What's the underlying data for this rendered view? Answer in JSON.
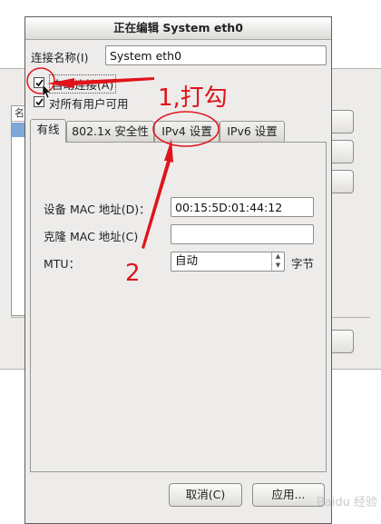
{
  "dialog": {
    "title": "正在编辑 System eth0",
    "connection_name_label": "连接名称(I)",
    "connection_name_value": "System eth0",
    "auto_connect_label": "自动连接(A)",
    "auto_connect_checked": true,
    "all_users_label": "对所有用户可用",
    "all_users_checked": true
  },
  "tabs": [
    {
      "label": "有线",
      "active": true
    },
    {
      "label": "802.1x 安全性",
      "active": false
    },
    {
      "label": "IPv4 设置",
      "active": false
    },
    {
      "label": "IPv6 设置",
      "active": false
    }
  ],
  "wired": {
    "mac_label": "设备 MAC 地址(D)：",
    "mac_value": "00:15:5D:01:44:12",
    "clone_mac_label": "克隆 MAC 地址(C)",
    "clone_mac_value": "",
    "mtu_label": "MTU：",
    "mtu_value": "自动",
    "mtu_unit": "字节"
  },
  "buttons": {
    "cancel": "取消(C)",
    "apply": "应用..."
  },
  "background_window": {
    "list_header": "名"
  },
  "annotations": {
    "step1": "1,打勾",
    "step2": "2",
    "color": "#e0141b"
  },
  "watermark": "Baidu 经验"
}
